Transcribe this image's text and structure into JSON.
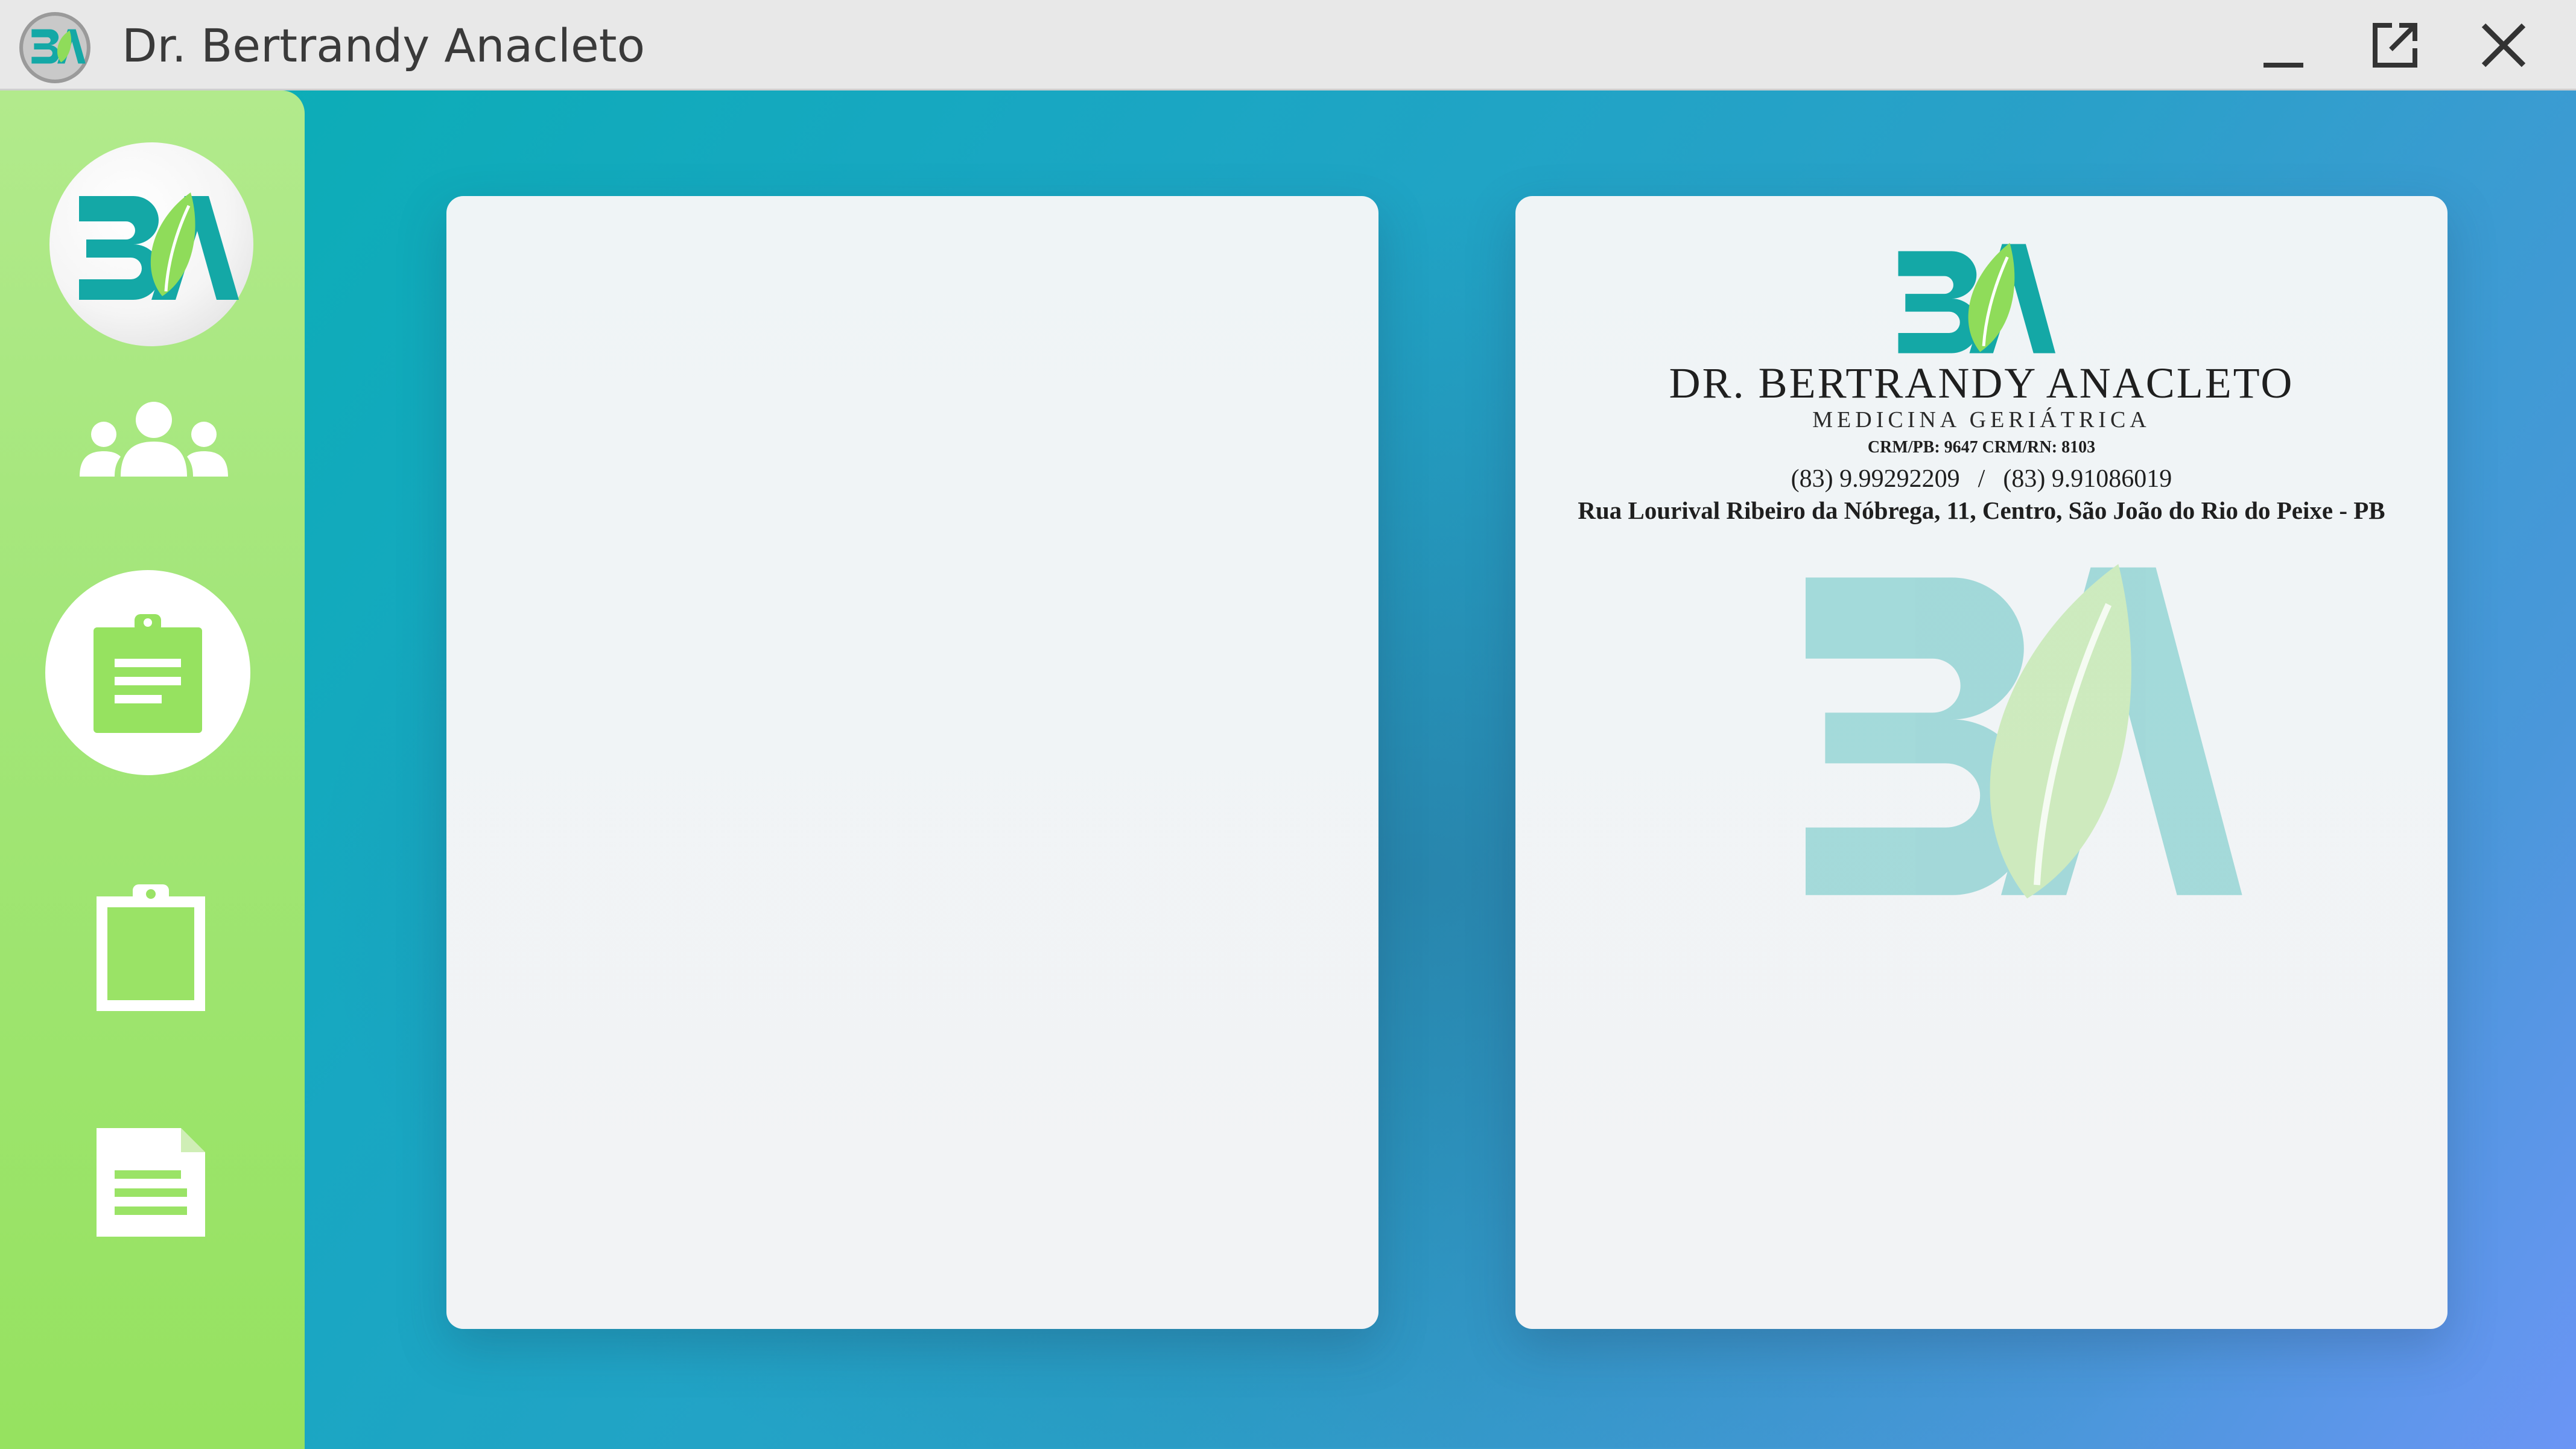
{
  "window": {
    "title": "Dr. Bertrandy Anacleto",
    "app_icon": "ba-logo-icon",
    "controls": {
      "minimize_icon": "minimize-icon",
      "popout_icon": "external-window-icon",
      "close_icon": "close-icon"
    }
  },
  "sidebar": {
    "items": [
      {
        "name": "home-logo",
        "icon": "ba-logo-icon",
        "active": false
      },
      {
        "name": "patients",
        "icon": "users-group-icon",
        "active": false
      },
      {
        "name": "prescription",
        "icon": "clipboard-list-icon",
        "active": true
      },
      {
        "name": "records",
        "icon": "clipboard-icon",
        "active": false
      },
      {
        "name": "documents",
        "icon": "document-text-icon",
        "active": false
      }
    ]
  },
  "colors": {
    "teal": "#14a8a6",
    "leaf": "#8fdc5a",
    "sidebar": "#a3e679",
    "background_start": "#08afb3",
    "background_end": "#6b95f5",
    "panel": "#f1f4f6"
  },
  "letterhead": {
    "name": "DR. BERTRANDY ANACLETO",
    "specialty": "MEDICINA GERIÁTRICA",
    "crm": "CRM/PB: 9647 CRM/RN: 8103",
    "phone_1": "(83) 9.99292209",
    "phone_separator": "/",
    "phone_2": "(83) 9.91086019",
    "address": "Rua Lourival Ribeiro da Nóbrega, 11, Centro, São João do Rio do Peixe - PB"
  }
}
